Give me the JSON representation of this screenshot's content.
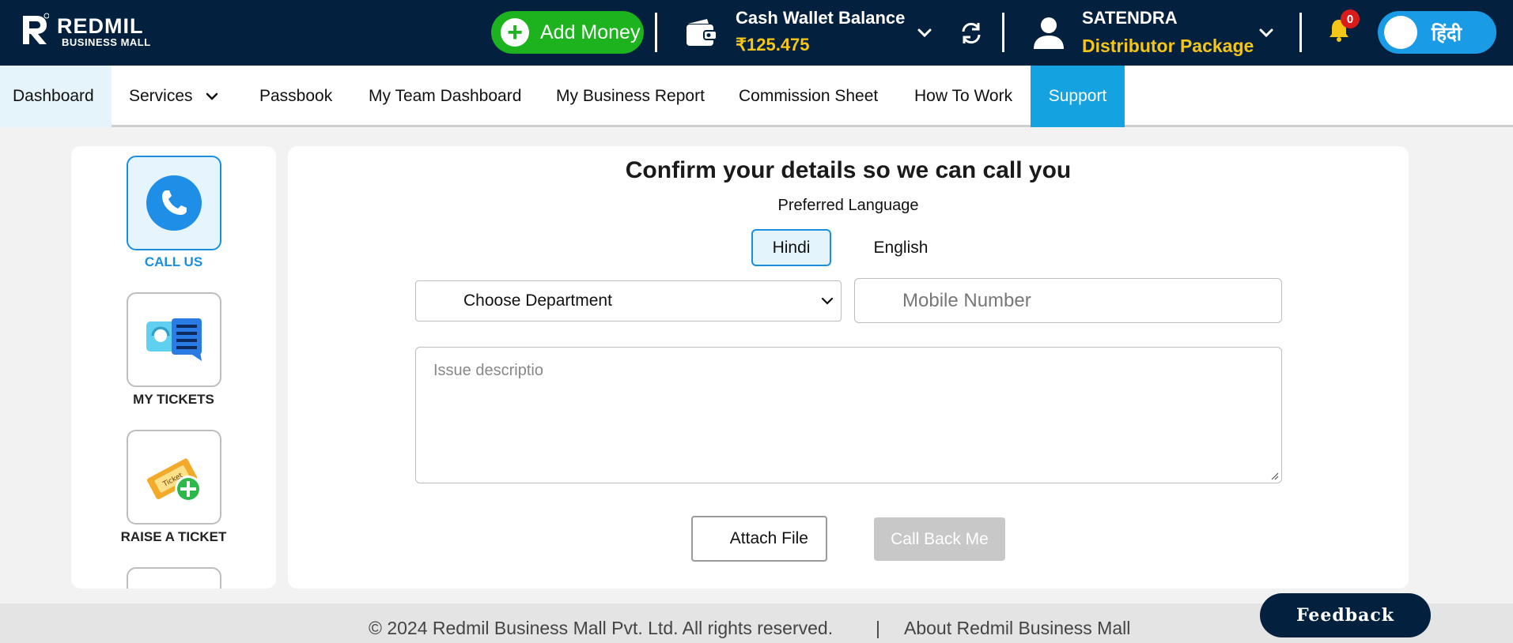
{
  "colors": {
    "header_bg": "#03213f",
    "accent_green": "#1db31f",
    "accent_blue": "#14a3e0",
    "highlight_yellow": "#f5c518"
  },
  "header": {
    "logo_name": "REDMIL",
    "logo_sub": "BUSINESS MALL",
    "add_money_label": "Add Money",
    "wallet_title": "Cash Wallet Balance",
    "wallet_amount": "₹125.475",
    "user_name": "SATENDRA",
    "user_package": "Distributor Package",
    "notification_count": "0",
    "language_toggle": "हिंदी"
  },
  "nav": {
    "items": [
      {
        "label": "Dashboard"
      },
      {
        "label": "Services"
      },
      {
        "label": "Passbook"
      },
      {
        "label": "My Team Dashboard"
      },
      {
        "label": "My Business Report"
      },
      {
        "label": "Commission Sheet"
      },
      {
        "label": "How To Work"
      },
      {
        "label": "Support"
      }
    ]
  },
  "sidebar": {
    "items": [
      {
        "label": "CALL US",
        "icon": "phone-icon"
      },
      {
        "label": "MY TICKETS",
        "icon": "ticket-chat-icon"
      },
      {
        "label": "RAISE A TICKET",
        "icon": "raise-ticket-icon"
      }
    ]
  },
  "form": {
    "title": "Confirm your details so we can call you",
    "preferred_language_label": "Preferred Language",
    "languages": [
      "Hindi",
      "English"
    ],
    "department_selected": "Choose Department",
    "mobile_placeholder": "Mobile Number",
    "description_placeholder": "Issue descriptio",
    "attach_label": "Attach File",
    "callback_label": "Call Back Me"
  },
  "footer": {
    "copyright": "© 2024 Redmil Business Mall Pvt. Ltd. All rights reserved.",
    "separator": "|",
    "about": "About Redmil Business Mall"
  },
  "feedback_label": "Feedback"
}
